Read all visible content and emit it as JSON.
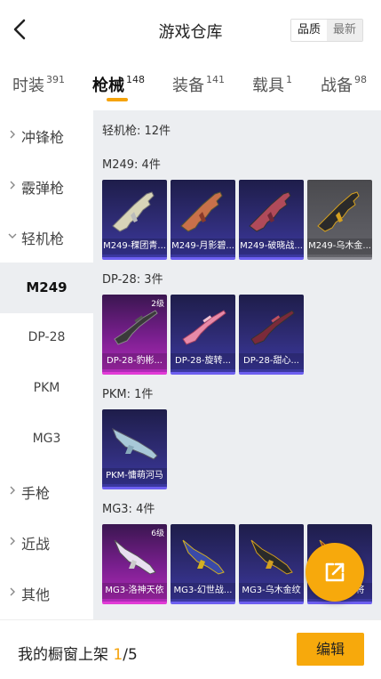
{
  "header": {
    "title": "游戏仓库",
    "sort_quality": "品质",
    "sort_latest": "最新"
  },
  "tabs": [
    {
      "label": "时装",
      "count": "391"
    },
    {
      "label": "枪械",
      "count": "148"
    },
    {
      "label": "装备",
      "count": "141"
    },
    {
      "label": "载具",
      "count": "1"
    },
    {
      "label": "战备",
      "count": "98"
    }
  ],
  "sidebar": [
    {
      "label": "冲锋枪"
    },
    {
      "label": "霰弹枪"
    },
    {
      "label": "轻机枪"
    },
    {
      "label": "M249"
    },
    {
      "label": "DP-28"
    },
    {
      "label": "PKM"
    },
    {
      "label": "MG3"
    },
    {
      "label": "手枪"
    },
    {
      "label": "近战"
    },
    {
      "label": "其他"
    }
  ],
  "main": {
    "category_summary": "轻机枪: 12件",
    "sections": [
      {
        "title": "M249: 4件",
        "items": [
          {
            "name": "M249-稞团青...",
            "rarity": "purple"
          },
          {
            "name": "M249-月影碧...",
            "rarity": "purple"
          },
          {
            "name": "M249-破晓战...",
            "rarity": "purple"
          },
          {
            "name": "M249-乌木金...",
            "rarity": "gray"
          }
        ]
      },
      {
        "title": "DP-28: 3件",
        "items": [
          {
            "name": "DP-28-豹彬...",
            "rarity": "magenta",
            "level": "2级"
          },
          {
            "name": "DP-28-旋转...",
            "rarity": "purple"
          },
          {
            "name": "DP-28-甜心...",
            "rarity": "purple"
          }
        ]
      },
      {
        "title": "PKM: 1件",
        "items": [
          {
            "name": "PKM-慵萌河马",
            "rarity": "purple"
          }
        ]
      },
      {
        "title": "MG3: 4件",
        "items": [
          {
            "name": "MG3-洛神天依",
            "rarity": "magenta",
            "level": "6级"
          },
          {
            "name": "MG3-幻世战...",
            "rarity": "purple"
          },
          {
            "name": "MG3-乌木金纹",
            "rarity": "purple"
          },
          {
            "name": "MG3-...福将",
            "rarity": "purple"
          }
        ]
      }
    ]
  },
  "footer": {
    "label": "我的橱窗上架",
    "current": "1",
    "total": "/5",
    "edit_label": "编辑"
  },
  "colors": {
    "accent": "#f7a90c",
    "panel_bg": "#eceef1",
    "purple": "#3b38a0",
    "magenta": "#b02ab8"
  },
  "icons": {
    "back": "chevron-left-icon",
    "fab": "external-link-icon"
  }
}
